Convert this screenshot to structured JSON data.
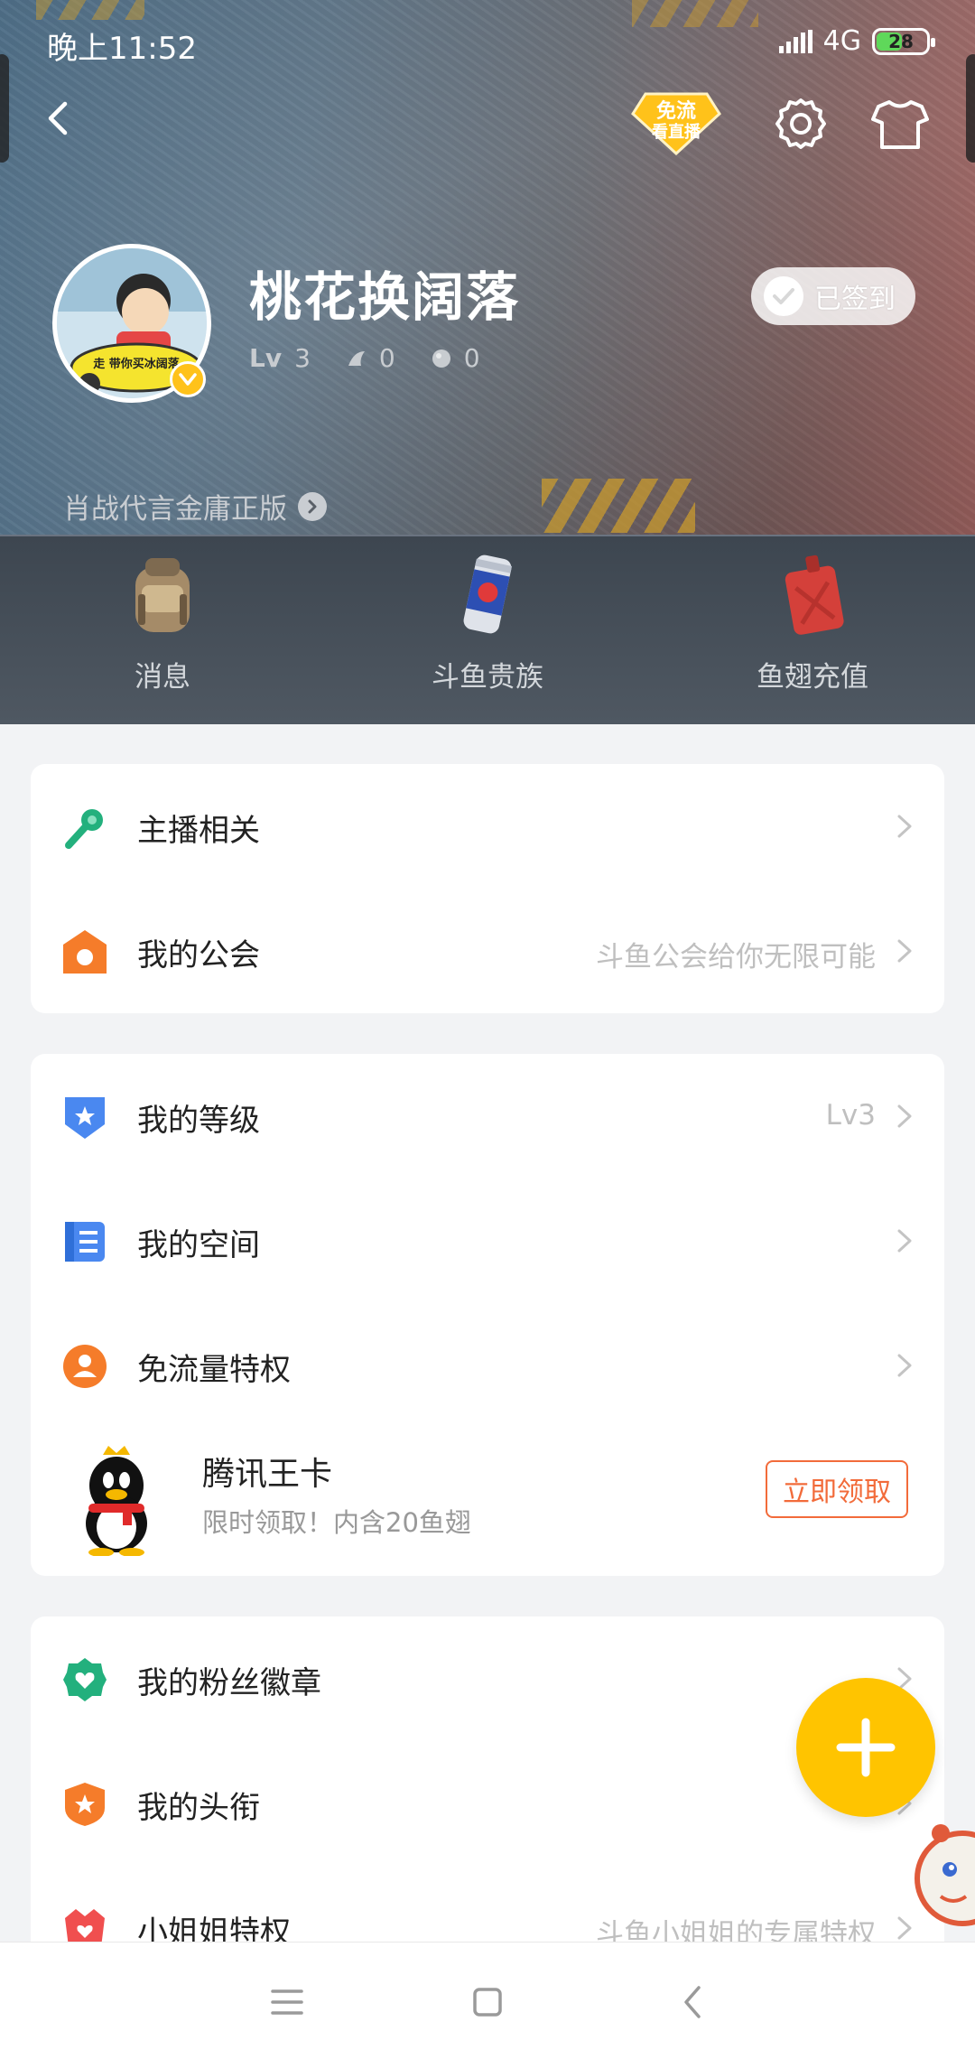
{
  "status_bar": {
    "time": "晚上11:52",
    "network": "4G",
    "battery": "28"
  },
  "header": {
    "free_badge_line1": "免流",
    "free_badge_line2": "看直播",
    "accent_badge": "#ffc21a"
  },
  "profile": {
    "username": "桃花换阔落",
    "level_label": "Lv",
    "level_value": "3",
    "fish_fins": "0",
    "fish_balls": "0",
    "checkin_label": "已签到",
    "motto": "肖战代言金庸正版",
    "avatar_caption": "走 带你买冰阔落"
  },
  "quick_actions": [
    {
      "label": "消息",
      "icon": "backpack-icon"
    },
    {
      "label": "斗鱼贵族",
      "icon": "energy-can-icon"
    },
    {
      "label": "鱼翅充值",
      "icon": "fuel-can-icon"
    }
  ],
  "menu": {
    "group1": [
      {
        "label": "主播相关",
        "hint": "",
        "icon": "microphone-icon",
        "color": "#23b07d"
      },
      {
        "label": "我的公会",
        "hint": "斗鱼公会给你无限可能",
        "icon": "guild-house-icon",
        "color": "#f57c2a"
      }
    ],
    "group2": [
      {
        "label": "我的等级",
        "hint": "Lv3",
        "icon": "level-shield-icon",
        "color": "#4a88f0"
      },
      {
        "label": "我的空间",
        "hint": "",
        "icon": "space-doc-icon",
        "color": "#4a88f0"
      },
      {
        "label": "免流量特权",
        "hint": "",
        "icon": "free-data-icon",
        "color": "#f57c2a"
      }
    ],
    "tencent_card": {
      "title": "腾讯王卡",
      "subtitle": "限时领取！内含20鱼翅",
      "button": "立即领取"
    },
    "group3": [
      {
        "label": "我的粉丝徽章",
        "hint": "",
        "icon": "fan-badge-icon",
        "color": "#23b07d"
      },
      {
        "label": "我的头衔",
        "hint": "",
        "icon": "title-badge-icon",
        "color": "#f57c2a"
      },
      {
        "label": "小姐姐特权",
        "hint": "斗鱼小姐姐的专属特权",
        "icon": "girl-privilege-icon",
        "color": "#f04f4f"
      }
    ]
  },
  "colors": {
    "accent_orange": "#f26b3a",
    "fab_yellow": "#ffc400",
    "background": "#f2f3f5"
  }
}
